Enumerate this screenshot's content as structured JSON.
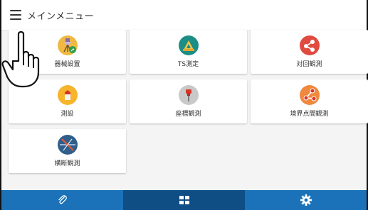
{
  "header": {
    "title": "メインメニュー",
    "menu_icon": "hamburger-icon"
  },
  "menu": {
    "items": [
      {
        "label": "器械設置",
        "icon": "instrument-setup-icon",
        "color": "#f0b942"
      },
      {
        "label": "TS測定",
        "icon": "ts-measure-icon",
        "color": "#1c8e86"
      },
      {
        "label": "対回観測",
        "icon": "round-observation-icon",
        "color": "#e04a3f"
      },
      {
        "label": "測設",
        "icon": "stakeout-icon",
        "color": "#f6b52c"
      },
      {
        "label": "座標観測",
        "icon": "coordinate-observation-icon",
        "color": "#c9c9c9"
      },
      {
        "label": "境界点間観測",
        "icon": "boundary-observation-icon",
        "color": "#f0883e"
      },
      {
        "label": "横断観測",
        "icon": "cross-section-icon",
        "color": "#2f5f8a"
      }
    ]
  },
  "bottom_nav": {
    "tabs": [
      {
        "name": "attachment",
        "icon": "paperclip-icon"
      },
      {
        "name": "menu",
        "icon": "grid-icon",
        "active": true
      },
      {
        "name": "settings",
        "icon": "gear-icon"
      }
    ],
    "color": "#1b72b8",
    "active_color": "#0e4e85"
  },
  "overlay": {
    "icon": "pointing-hand-icon"
  }
}
